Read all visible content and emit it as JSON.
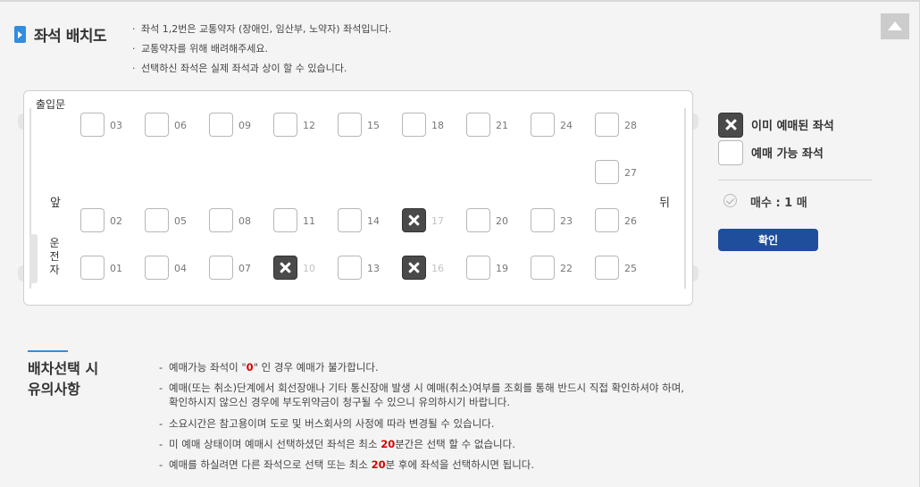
{
  "header": {
    "title": "좌석 배치도",
    "notes": [
      "좌석 1,2번은 교통약자 (장애인, 임산부, 노약자) 좌석입니다.",
      "교통약자를 위해 배려해주세요.",
      "선택하신 좌석은 실제 좌석과 상이 할 수 있습니다."
    ]
  },
  "seat_map": {
    "entrance_label": "출입문",
    "front_label": "앞",
    "back_label": "뒤",
    "driver_label": "운전자",
    "top_row": [
      "03",
      "06",
      "09",
      "12",
      "15",
      "18",
      "21",
      "24",
      "28"
    ],
    "extra_seat": "27",
    "middle_row": [
      "02",
      "05",
      "08",
      "11",
      "14",
      "17",
      "20",
      "23",
      "26"
    ],
    "bottom_row": [
      "01",
      "04",
      "07",
      "10",
      "13",
      "16",
      "19",
      "22",
      "25"
    ],
    "booked": [
      "17",
      "10",
      "16"
    ]
  },
  "legend": {
    "booked_label": "이미 예매된 좌석",
    "available_label": "예매 가능 좌석",
    "count_label": "매수 : 1 매",
    "confirm_label": "확인"
  },
  "caution": {
    "title_line1": "배차선택 시",
    "title_line2": "유의사항",
    "item1_pre": "예매가능 좌석이 \"",
    "item1_hl": "0",
    "item1_post": "\" 인 경우 예매가 불가합니다.",
    "item2_line1": "예매(또는 취소)단계에서 회선장애나 기타 통신장애 발생 시 예매(취소)여부를 조회를 통해 반드시 직접 확인하셔야 하며,",
    "item2_line2": "확인하시지 않으신 경우에 부도위약금이 청구될 수 있으니 유의하시기 바랍니다.",
    "item3": "소요시간은 참고용이며 도로 및 버스회사의 사정에 따라 변경될 수 있습니다.",
    "item4_pre": "미 예매 상태이며 예매시 선택하셨던 좌석은 최소 ",
    "item4_hl": "20",
    "item4_post": "분간은 선택 할 수 없습니다.",
    "item5_pre": "예매를 하실려면 다른 좌석으로 선택 또는 최소 ",
    "item5_hl": "20",
    "item5_post": "분 후에 좌석을 선택하시면 됩니다."
  },
  "colors": {
    "accent_blue": "#2f8ee0",
    "button_navy": "#1e4e9c",
    "booked_seat": "#4a4a4a",
    "highlight_red": "#d60000"
  }
}
